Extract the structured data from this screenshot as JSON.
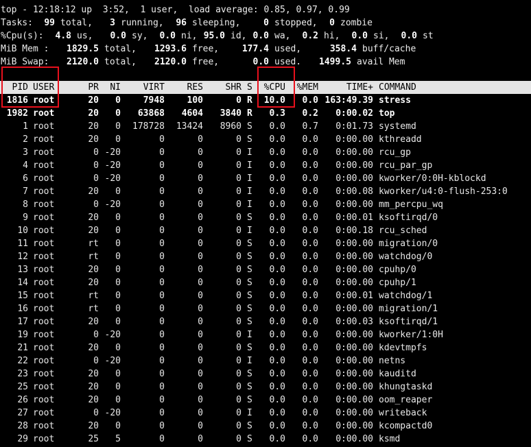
{
  "accent": {
    "highlight_box": "#e8101c",
    "header_bg": "#e4e4e4"
  },
  "summary": {
    "line1": "top - 12:18:12 up  3:52,  1 user,  load average: 0.85, 0.97, 0.99",
    "tasks": {
      "label": "Tasks:",
      "total": "99",
      "total_l": "total,",
      "running": "3",
      "running_l": "running,",
      "sleeping": "96",
      "sleeping_l": "sleeping,",
      "stopped": "0",
      "stopped_l": "stopped,",
      "zombie": "0",
      "zombie_l": "zombie"
    },
    "cpu": {
      "label": "%Cpu(s):",
      "us": "4.8",
      "us_l": "us,",
      "sy": "0.0",
      "sy_l": "sy,",
      "ni": "0.0",
      "ni_l": "ni,",
      "id": "95.0",
      "id_l": "id,",
      "wa": "0.0",
      "wa_l": "wa,",
      "hi": "0.2",
      "hi_l": "hi,",
      "si": "0.0",
      "si_l": "si,",
      "st": "0.0",
      "st_l": "st"
    },
    "mem": {
      "label": "MiB Mem :",
      "total": "1829.5",
      "total_l": "total,",
      "free": "1293.6",
      "free_l": "free,",
      "used": "177.4",
      "used_l": "used,",
      "buff": "358.4",
      "buff_l": "buff/cache"
    },
    "swap": {
      "label": "MiB Swap:",
      "total": "2120.0",
      "total_l": "total,",
      "free": "2120.0",
      "free_l": "free,",
      "used": "0.0",
      "used_l": "used.",
      "avail": "1499.5",
      "avail_l": "avail Mem"
    }
  },
  "columns": {
    "pid": "PID",
    "user": "USER",
    "pr": "PR",
    "ni": "NI",
    "virt": "VIRT",
    "res": "RES",
    "shr": "SHR",
    "s": "S",
    "cpu": "%CPU",
    "mem": "%MEM",
    "time": "TIME+",
    "command": "COMMAND"
  },
  "processes": [
    {
      "pid": "1816",
      "user": "root",
      "pr": "20",
      "ni": "0",
      "virt": "7948",
      "res": "100",
      "shr": "0",
      "s": "R",
      "cpu": "10.0",
      "mem": "0.0",
      "time": "163:49.39",
      "command": "stress",
      "bold": true
    },
    {
      "pid": "1982",
      "user": "root",
      "pr": "20",
      "ni": "0",
      "virt": "63868",
      "res": "4604",
      "shr": "3840",
      "s": "R",
      "cpu": "0.3",
      "mem": "0.2",
      "time": "0:00.02",
      "command": "top",
      "bold": true
    },
    {
      "pid": "1",
      "user": "root",
      "pr": "20",
      "ni": "0",
      "virt": "178728",
      "res": "13424",
      "shr": "8960",
      "s": "S",
      "cpu": "0.0",
      "mem": "0.7",
      "time": "0:01.73",
      "command": "systemd"
    },
    {
      "pid": "2",
      "user": "root",
      "pr": "20",
      "ni": "0",
      "virt": "0",
      "res": "0",
      "shr": "0",
      "s": "S",
      "cpu": "0.0",
      "mem": "0.0",
      "time": "0:00.00",
      "command": "kthreadd"
    },
    {
      "pid": "3",
      "user": "root",
      "pr": "0",
      "ni": "-20",
      "virt": "0",
      "res": "0",
      "shr": "0",
      "s": "I",
      "cpu": "0.0",
      "mem": "0.0",
      "time": "0:00.00",
      "command": "rcu_gp"
    },
    {
      "pid": "4",
      "user": "root",
      "pr": "0",
      "ni": "-20",
      "virt": "0",
      "res": "0",
      "shr": "0",
      "s": "I",
      "cpu": "0.0",
      "mem": "0.0",
      "time": "0:00.00",
      "command": "rcu_par_gp"
    },
    {
      "pid": "6",
      "user": "root",
      "pr": "0",
      "ni": "-20",
      "virt": "0",
      "res": "0",
      "shr": "0",
      "s": "I",
      "cpu": "0.0",
      "mem": "0.0",
      "time": "0:00.00",
      "command": "kworker/0:0H-kblockd"
    },
    {
      "pid": "7",
      "user": "root",
      "pr": "20",
      "ni": "0",
      "virt": "0",
      "res": "0",
      "shr": "0",
      "s": "I",
      "cpu": "0.0",
      "mem": "0.0",
      "time": "0:00.08",
      "command": "kworker/u4:0-flush-253:0"
    },
    {
      "pid": "8",
      "user": "root",
      "pr": "0",
      "ni": "-20",
      "virt": "0",
      "res": "0",
      "shr": "0",
      "s": "I",
      "cpu": "0.0",
      "mem": "0.0",
      "time": "0:00.00",
      "command": "mm_percpu_wq"
    },
    {
      "pid": "9",
      "user": "root",
      "pr": "20",
      "ni": "0",
      "virt": "0",
      "res": "0",
      "shr": "0",
      "s": "S",
      "cpu": "0.0",
      "mem": "0.0",
      "time": "0:00.01",
      "command": "ksoftirqd/0"
    },
    {
      "pid": "10",
      "user": "root",
      "pr": "20",
      "ni": "0",
      "virt": "0",
      "res": "0",
      "shr": "0",
      "s": "I",
      "cpu": "0.0",
      "mem": "0.0",
      "time": "0:00.18",
      "command": "rcu_sched"
    },
    {
      "pid": "11",
      "user": "root",
      "pr": "rt",
      "ni": "0",
      "virt": "0",
      "res": "0",
      "shr": "0",
      "s": "S",
      "cpu": "0.0",
      "mem": "0.0",
      "time": "0:00.00",
      "command": "migration/0"
    },
    {
      "pid": "12",
      "user": "root",
      "pr": "rt",
      "ni": "0",
      "virt": "0",
      "res": "0",
      "shr": "0",
      "s": "S",
      "cpu": "0.0",
      "mem": "0.0",
      "time": "0:00.00",
      "command": "watchdog/0"
    },
    {
      "pid": "13",
      "user": "root",
      "pr": "20",
      "ni": "0",
      "virt": "0",
      "res": "0",
      "shr": "0",
      "s": "S",
      "cpu": "0.0",
      "mem": "0.0",
      "time": "0:00.00",
      "command": "cpuhp/0"
    },
    {
      "pid": "14",
      "user": "root",
      "pr": "20",
      "ni": "0",
      "virt": "0",
      "res": "0",
      "shr": "0",
      "s": "S",
      "cpu": "0.0",
      "mem": "0.0",
      "time": "0:00.00",
      "command": "cpuhp/1"
    },
    {
      "pid": "15",
      "user": "root",
      "pr": "rt",
      "ni": "0",
      "virt": "0",
      "res": "0",
      "shr": "0",
      "s": "S",
      "cpu": "0.0",
      "mem": "0.0",
      "time": "0:00.01",
      "command": "watchdog/1"
    },
    {
      "pid": "16",
      "user": "root",
      "pr": "rt",
      "ni": "0",
      "virt": "0",
      "res": "0",
      "shr": "0",
      "s": "S",
      "cpu": "0.0",
      "mem": "0.0",
      "time": "0:00.00",
      "command": "migration/1"
    },
    {
      "pid": "17",
      "user": "root",
      "pr": "20",
      "ni": "0",
      "virt": "0",
      "res": "0",
      "shr": "0",
      "s": "S",
      "cpu": "0.0",
      "mem": "0.0",
      "time": "0:00.03",
      "command": "ksoftirqd/1"
    },
    {
      "pid": "19",
      "user": "root",
      "pr": "0",
      "ni": "-20",
      "virt": "0",
      "res": "0",
      "shr": "0",
      "s": "I",
      "cpu": "0.0",
      "mem": "0.0",
      "time": "0:00.00",
      "command": "kworker/1:0H"
    },
    {
      "pid": "21",
      "user": "root",
      "pr": "20",
      "ni": "0",
      "virt": "0",
      "res": "0",
      "shr": "0",
      "s": "S",
      "cpu": "0.0",
      "mem": "0.0",
      "time": "0:00.00",
      "command": "kdevtmpfs"
    },
    {
      "pid": "22",
      "user": "root",
      "pr": "0",
      "ni": "-20",
      "virt": "0",
      "res": "0",
      "shr": "0",
      "s": "I",
      "cpu": "0.0",
      "mem": "0.0",
      "time": "0:00.00",
      "command": "netns"
    },
    {
      "pid": "23",
      "user": "root",
      "pr": "20",
      "ni": "0",
      "virt": "0",
      "res": "0",
      "shr": "0",
      "s": "S",
      "cpu": "0.0",
      "mem": "0.0",
      "time": "0:00.00",
      "command": "kauditd"
    },
    {
      "pid": "25",
      "user": "root",
      "pr": "20",
      "ni": "0",
      "virt": "0",
      "res": "0",
      "shr": "0",
      "s": "S",
      "cpu": "0.0",
      "mem": "0.0",
      "time": "0:00.00",
      "command": "khungtaskd"
    },
    {
      "pid": "26",
      "user": "root",
      "pr": "20",
      "ni": "0",
      "virt": "0",
      "res": "0",
      "shr": "0",
      "s": "S",
      "cpu": "0.0",
      "mem": "0.0",
      "time": "0:00.00",
      "command": "oom_reaper"
    },
    {
      "pid": "27",
      "user": "root",
      "pr": "0",
      "ni": "-20",
      "virt": "0",
      "res": "0",
      "shr": "0",
      "s": "I",
      "cpu": "0.0",
      "mem": "0.0",
      "time": "0:00.00",
      "command": "writeback"
    },
    {
      "pid": "28",
      "user": "root",
      "pr": "20",
      "ni": "0",
      "virt": "0",
      "res": "0",
      "shr": "0",
      "s": "S",
      "cpu": "0.0",
      "mem": "0.0",
      "time": "0:00.00",
      "command": "kcompactd0"
    },
    {
      "pid": "29",
      "user": "root",
      "pr": "25",
      "ni": "5",
      "virt": "0",
      "res": "0",
      "shr": "0",
      "s": "S",
      "cpu": "0.0",
      "mem": "0.0",
      "time": "0:00.00",
      "command": "ksmd"
    }
  ]
}
